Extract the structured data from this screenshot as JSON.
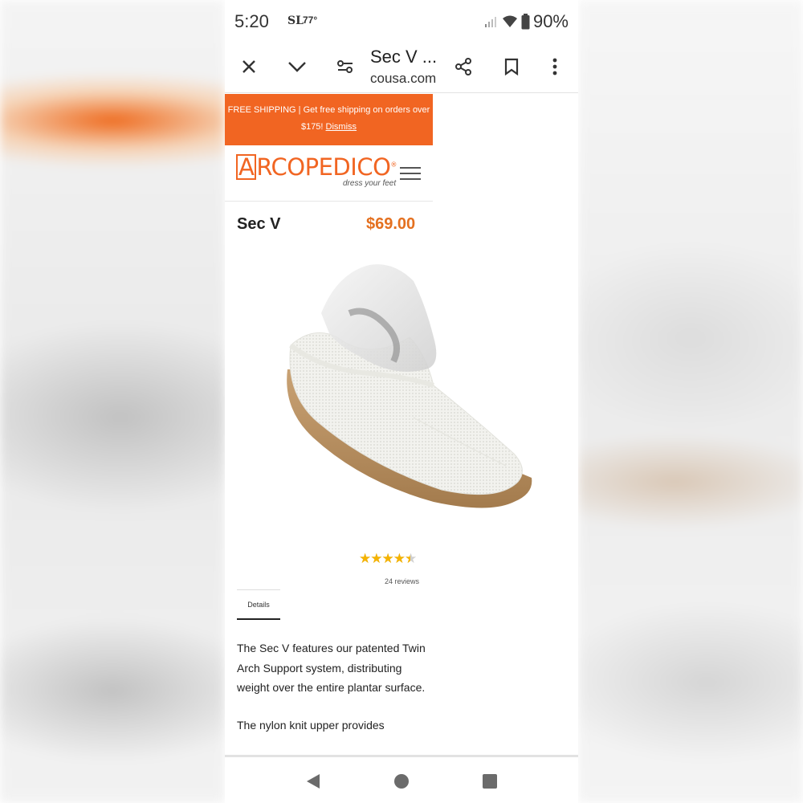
{
  "status_bar": {
    "time": "5:20",
    "app_icon_text": "SL",
    "temperature": "77°",
    "battery": "90%"
  },
  "browser": {
    "page_title": "Sec V ...",
    "url": "cousa.com",
    "icons": [
      "close-icon",
      "chevron-down-icon",
      "settings-sliders-icon",
      "share-icon",
      "bookmark-icon",
      "more-vert-icon"
    ]
  },
  "banner": {
    "line1": "FREE SHIPPING | Get free shipping on orders over",
    "line2": "$175!",
    "dismiss": "Dismiss",
    "color": "#f16522"
  },
  "header": {
    "logo_initial": "A",
    "logo_text": "RCOPEDICO",
    "logo_mark": "®",
    "tagline": "dress your feet",
    "brand_color": "#f16522"
  },
  "product": {
    "name": "Sec V",
    "price": "$69.00",
    "price_color": "#e4701f",
    "rating": 4.5,
    "rating_max": 5,
    "stars": "★★★★★",
    "reviews": "24 reviews",
    "tab": "Details",
    "description": [
      "The Sec V features our patented Twin Arch Support system, distributing weight over the entire plantar surface.",
      "The nylon knit upper provides"
    ]
  },
  "nav": {
    "icons": [
      "back-icon",
      "home-icon",
      "recents-icon"
    ]
  }
}
